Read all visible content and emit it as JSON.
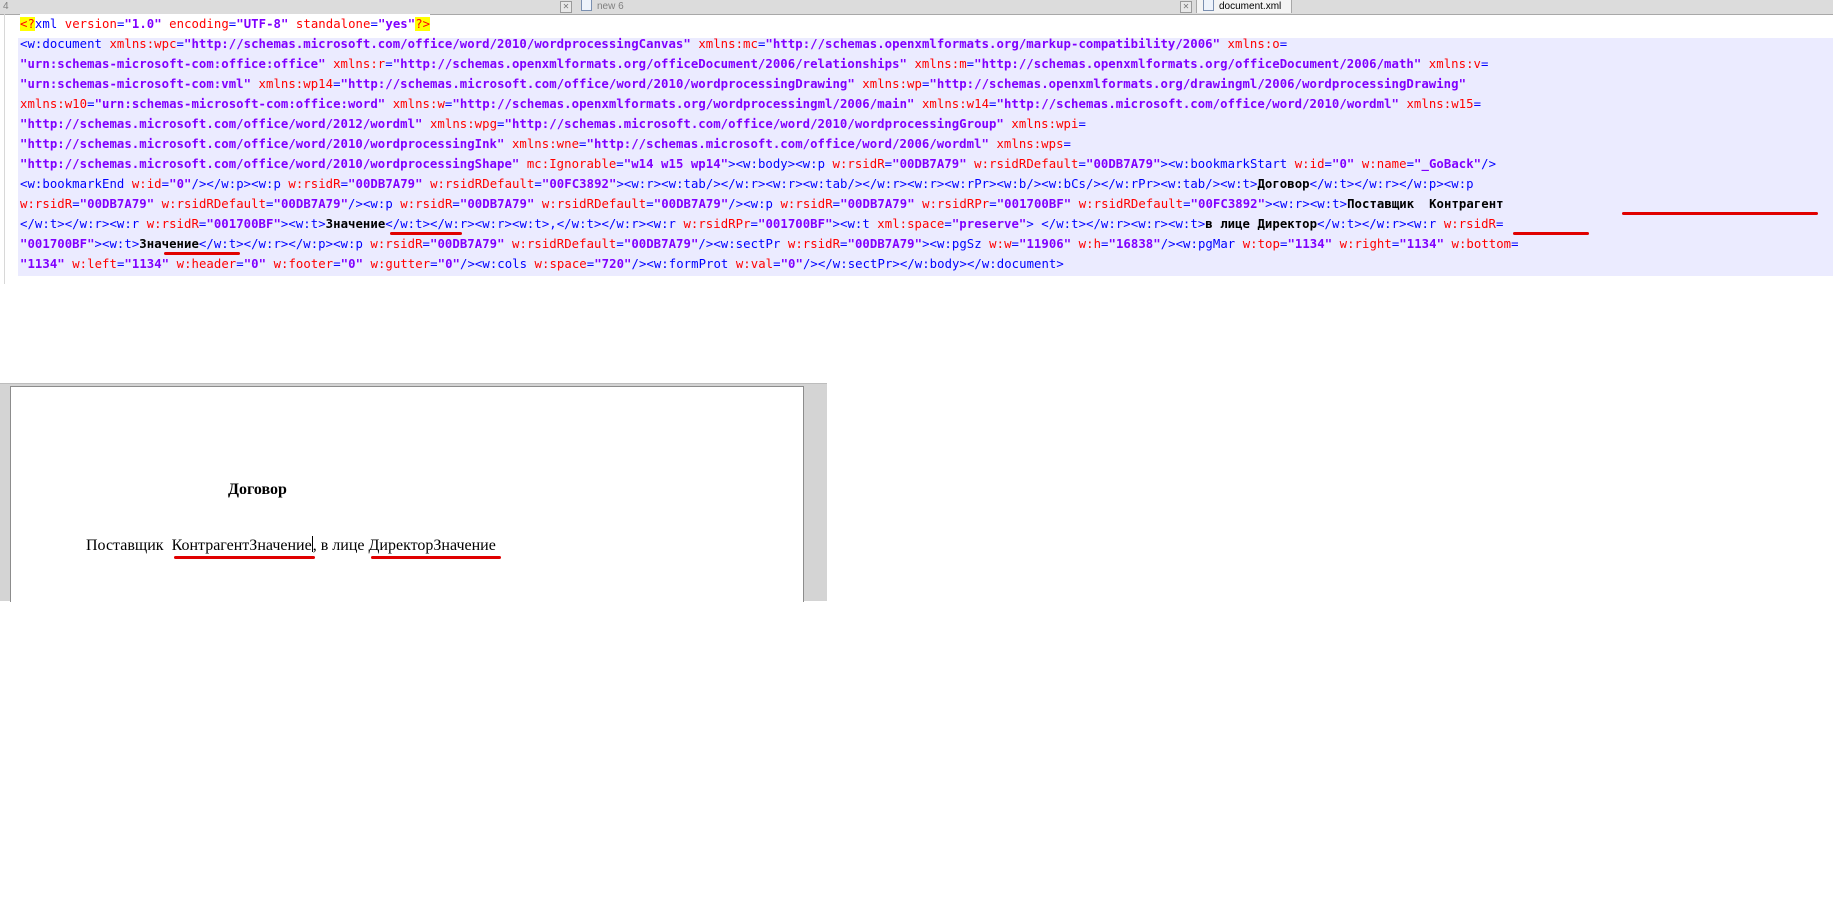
{
  "tabs": [
    {
      "label": "4",
      "active": false
    },
    {
      "label": "new 6",
      "active": false
    },
    {
      "label": "document.xml",
      "active": true
    }
  ],
  "editor": {
    "line1": [
      {
        "cls": "pi",
        "t": "<?"
      },
      {
        "cls": "tag",
        "t": "xml "
      },
      {
        "cls": "attr",
        "t": "version"
      },
      {
        "cls": "tag",
        "t": "="
      },
      {
        "cls": "val",
        "t": "\"1.0\""
      },
      {
        "cls": "tag",
        "t": " "
      },
      {
        "cls": "attr",
        "t": "encoding"
      },
      {
        "cls": "tag",
        "t": "="
      },
      {
        "cls": "val",
        "t": "\"UTF-8\""
      },
      {
        "cls": "tag",
        "t": " "
      },
      {
        "cls": "attr",
        "t": "standalone"
      },
      {
        "cls": "tag",
        "t": "="
      },
      {
        "cls": "val",
        "t": "\"yes\""
      },
      {
        "cls": "pi",
        "t": "?>"
      }
    ],
    "lines": [
      [
        {
          "cls": "tag",
          "t": "<w:document "
        },
        {
          "cls": "attr",
          "t": "xmlns:wpc"
        },
        {
          "cls": "tag",
          "t": "="
        },
        {
          "cls": "val",
          "t": "\"http://schemas.microsoft.com/office/word/2010/wordprocessingCanvas\""
        },
        {
          "cls": "tag",
          "t": " "
        },
        {
          "cls": "attr",
          "t": "xmlns:mc"
        },
        {
          "cls": "tag",
          "t": "="
        },
        {
          "cls": "val",
          "t": "\"http://schemas.openxmlformats.org/markup-compatibility/2006\""
        },
        {
          "cls": "tag",
          "t": " "
        },
        {
          "cls": "attr",
          "t": "xmlns:o"
        },
        {
          "cls": "tag",
          "t": "="
        }
      ],
      [
        {
          "cls": "val",
          "t": "\"urn:schemas-microsoft-com:office:office\""
        },
        {
          "cls": "tag",
          "t": " "
        },
        {
          "cls": "attr",
          "t": "xmlns:r"
        },
        {
          "cls": "tag",
          "t": "="
        },
        {
          "cls": "val",
          "t": "\"http://schemas.openxmlformats.org/officeDocument/2006/relationships\""
        },
        {
          "cls": "tag",
          "t": " "
        },
        {
          "cls": "attr",
          "t": "xmlns:m"
        },
        {
          "cls": "tag",
          "t": "="
        },
        {
          "cls": "val",
          "t": "\"http://schemas.openxmlformats.org/officeDocument/2006/math\""
        },
        {
          "cls": "tag",
          "t": " "
        },
        {
          "cls": "attr",
          "t": "xmlns:v"
        },
        {
          "cls": "tag",
          "t": "="
        }
      ],
      [
        {
          "cls": "val",
          "t": "\"urn:schemas-microsoft-com:vml\""
        },
        {
          "cls": "tag",
          "t": " "
        },
        {
          "cls": "attr",
          "t": "xmlns:wp14"
        },
        {
          "cls": "tag",
          "t": "="
        },
        {
          "cls": "val",
          "t": "\"http://schemas.microsoft.com/office/word/2010/wordprocessingDrawing\""
        },
        {
          "cls": "tag",
          "t": " "
        },
        {
          "cls": "attr",
          "t": "xmlns:wp"
        },
        {
          "cls": "tag",
          "t": "="
        },
        {
          "cls": "val",
          "t": "\"http://schemas.openxmlformats.org/drawingml/2006/wordprocessingDrawing\""
        }
      ],
      [
        {
          "cls": "attr",
          "t": "xmlns:w10"
        },
        {
          "cls": "tag",
          "t": "="
        },
        {
          "cls": "val",
          "t": "\"urn:schemas-microsoft-com:office:word\""
        },
        {
          "cls": "tag",
          "t": " "
        },
        {
          "cls": "attr",
          "t": "xmlns:w"
        },
        {
          "cls": "tag",
          "t": "="
        },
        {
          "cls": "val",
          "t": "\"http://schemas.openxmlformats.org/wordprocessingml/2006/main\""
        },
        {
          "cls": "tag",
          "t": " "
        },
        {
          "cls": "attr",
          "t": "xmlns:w14"
        },
        {
          "cls": "tag",
          "t": "="
        },
        {
          "cls": "val",
          "t": "\"http://schemas.microsoft.com/office/word/2010/wordml\""
        },
        {
          "cls": "tag",
          "t": " "
        },
        {
          "cls": "attr",
          "t": "xmlns:w15"
        },
        {
          "cls": "tag",
          "t": "="
        }
      ],
      [
        {
          "cls": "val",
          "t": "\"http://schemas.microsoft.com/office/word/2012/wordml\""
        },
        {
          "cls": "tag",
          "t": " "
        },
        {
          "cls": "attr",
          "t": "xmlns:wpg"
        },
        {
          "cls": "tag",
          "t": "="
        },
        {
          "cls": "val",
          "t": "\"http://schemas.microsoft.com/office/word/2010/wordprocessingGroup\""
        },
        {
          "cls": "tag",
          "t": " "
        },
        {
          "cls": "attr",
          "t": "xmlns:wpi"
        },
        {
          "cls": "tag",
          "t": "="
        }
      ],
      [
        {
          "cls": "val",
          "t": "\"http://schemas.microsoft.com/office/word/2010/wordprocessingInk\""
        },
        {
          "cls": "tag",
          "t": " "
        },
        {
          "cls": "attr",
          "t": "xmlns:wne"
        },
        {
          "cls": "tag",
          "t": "="
        },
        {
          "cls": "val",
          "t": "\"http://schemas.microsoft.com/office/word/2006/wordml\""
        },
        {
          "cls": "tag",
          "t": " "
        },
        {
          "cls": "attr",
          "t": "xmlns:wps"
        },
        {
          "cls": "tag",
          "t": "="
        }
      ],
      [
        {
          "cls": "val",
          "t": "\"http://schemas.microsoft.com/office/word/2010/wordprocessingShape\""
        },
        {
          "cls": "tag",
          "t": " "
        },
        {
          "cls": "attr",
          "t": "mc:Ignorable"
        },
        {
          "cls": "tag",
          "t": "="
        },
        {
          "cls": "val",
          "t": "\"w14 w15 wp14\""
        },
        {
          "cls": "tag",
          "t": "><w:body><w:p "
        },
        {
          "cls": "attr",
          "t": "w:rsidR"
        },
        {
          "cls": "tag",
          "t": "="
        },
        {
          "cls": "val",
          "t": "\"00DB7A79\""
        },
        {
          "cls": "tag",
          "t": " "
        },
        {
          "cls": "attr",
          "t": "w:rsidRDefault"
        },
        {
          "cls": "tag",
          "t": "="
        },
        {
          "cls": "val",
          "t": "\"00DB7A79\""
        },
        {
          "cls": "tag",
          "t": "><w:bookmarkStart "
        },
        {
          "cls": "attr",
          "t": "w:id"
        },
        {
          "cls": "tag",
          "t": "="
        },
        {
          "cls": "val",
          "t": "\"0\""
        },
        {
          "cls": "tag",
          "t": " "
        },
        {
          "cls": "attr",
          "t": "w:name"
        },
        {
          "cls": "tag",
          "t": "="
        },
        {
          "cls": "val",
          "t": "\"_GoBack\""
        },
        {
          "cls": "tag",
          "t": "/>"
        }
      ],
      [
        {
          "cls": "tag",
          "t": "<w:bookmarkEnd "
        },
        {
          "cls": "attr",
          "t": "w:id"
        },
        {
          "cls": "tag",
          "t": "="
        },
        {
          "cls": "val",
          "t": "\"0\""
        },
        {
          "cls": "tag",
          "t": "/></w:p><w:p "
        },
        {
          "cls": "attr",
          "t": "w:rsidR"
        },
        {
          "cls": "tag",
          "t": "="
        },
        {
          "cls": "val",
          "t": "\"00DB7A79\""
        },
        {
          "cls": "tag",
          "t": " "
        },
        {
          "cls": "attr",
          "t": "w:rsidRDefault"
        },
        {
          "cls": "tag",
          "t": "="
        },
        {
          "cls": "val",
          "t": "\"00FC3892\""
        },
        {
          "cls": "tag",
          "t": "><w:r><w:tab/></w:r><w:r><w:tab/></w:r><w:r><w:rPr><w:b/><w:bCs/></w:rPr><w:tab/><w:t>"
        },
        {
          "cls": "txt",
          "t": "Договор"
        },
        {
          "cls": "tag",
          "t": "</w:t></w:r></w:p><w:p"
        }
      ],
      [
        {
          "cls": "attr",
          "t": "w:rsidR"
        },
        {
          "cls": "tag",
          "t": "="
        },
        {
          "cls": "val",
          "t": "\"00DB7A79\""
        },
        {
          "cls": "tag",
          "t": " "
        },
        {
          "cls": "attr",
          "t": "w:rsidRDefault"
        },
        {
          "cls": "tag",
          "t": "="
        },
        {
          "cls": "val",
          "t": "\"00DB7A79\""
        },
        {
          "cls": "tag",
          "t": "/><w:p "
        },
        {
          "cls": "attr",
          "t": "w:rsidR"
        },
        {
          "cls": "tag",
          "t": "="
        },
        {
          "cls": "val",
          "t": "\"00DB7A79\""
        },
        {
          "cls": "tag",
          "t": " "
        },
        {
          "cls": "attr",
          "t": "w:rsidRDefault"
        },
        {
          "cls": "tag",
          "t": "="
        },
        {
          "cls": "val",
          "t": "\"00DB7A79\""
        },
        {
          "cls": "tag",
          "t": "/><w:p "
        },
        {
          "cls": "attr",
          "t": "w:rsidR"
        },
        {
          "cls": "tag",
          "t": "="
        },
        {
          "cls": "val",
          "t": "\"00DB7A79\""
        },
        {
          "cls": "tag",
          "t": " "
        },
        {
          "cls": "attr",
          "t": "w:rsidRPr"
        },
        {
          "cls": "tag",
          "t": "="
        },
        {
          "cls": "val",
          "t": "\"001700BF\""
        },
        {
          "cls": "tag",
          "t": " "
        },
        {
          "cls": "attr",
          "t": "w:rsidRDefault"
        },
        {
          "cls": "tag",
          "t": "="
        },
        {
          "cls": "val",
          "t": "\"00FC3892\""
        },
        {
          "cls": "tag",
          "t": "><w:r><w:t>"
        },
        {
          "cls": "txt",
          "t": "Поставщик  Контрагент"
        }
      ],
      [
        {
          "cls": "tag",
          "t": "</w:t></w:r><w:r "
        },
        {
          "cls": "attr",
          "t": "w:rsidR"
        },
        {
          "cls": "tag",
          "t": "="
        },
        {
          "cls": "val",
          "t": "\"001700BF\""
        },
        {
          "cls": "tag",
          "t": "><w:t>"
        },
        {
          "cls": "txt",
          "t": "Значение"
        },
        {
          "cls": "tag",
          "t": "</w:t></w:r><w:r><w:t>,</w:t></w:r><w:r "
        },
        {
          "cls": "attr",
          "t": "w:rsidRPr"
        },
        {
          "cls": "tag",
          "t": "="
        },
        {
          "cls": "val",
          "t": "\"001700BF\""
        },
        {
          "cls": "tag",
          "t": "><w:t "
        },
        {
          "cls": "attr",
          "t": "xml:space"
        },
        {
          "cls": "tag",
          "t": "="
        },
        {
          "cls": "val",
          "t": "\"preserve\""
        },
        {
          "cls": "tag",
          "t": "> </w:t></w:r><w:r><w:t>"
        },
        {
          "cls": "txt",
          "t": "в лице Директор"
        },
        {
          "cls": "tag",
          "t": "</w:t></w:r><w:r "
        },
        {
          "cls": "attr",
          "t": "w:rsidR"
        },
        {
          "cls": "tag",
          "t": "="
        }
      ],
      [
        {
          "cls": "val",
          "t": "\"001700BF\""
        },
        {
          "cls": "tag",
          "t": "><w:t>"
        },
        {
          "cls": "txt",
          "t": "Значение"
        },
        {
          "cls": "tag",
          "t": "</w:t></w:r></w:p><w:p "
        },
        {
          "cls": "attr",
          "t": "w:rsidR"
        },
        {
          "cls": "tag",
          "t": "="
        },
        {
          "cls": "val",
          "t": "\"00DB7A79\""
        },
        {
          "cls": "tag",
          "t": " "
        },
        {
          "cls": "attr",
          "t": "w:rsidRDefault"
        },
        {
          "cls": "tag",
          "t": "="
        },
        {
          "cls": "val",
          "t": "\"00DB7A79\""
        },
        {
          "cls": "tag",
          "t": "/><w:sectPr "
        },
        {
          "cls": "attr",
          "t": "w:rsidR"
        },
        {
          "cls": "tag",
          "t": "="
        },
        {
          "cls": "val",
          "t": "\"00DB7A79\""
        },
        {
          "cls": "tag",
          "t": "><w:pgSz "
        },
        {
          "cls": "attr",
          "t": "w:w"
        },
        {
          "cls": "tag",
          "t": "="
        },
        {
          "cls": "val",
          "t": "\"11906\""
        },
        {
          "cls": "tag",
          "t": " "
        },
        {
          "cls": "attr",
          "t": "w:h"
        },
        {
          "cls": "tag",
          "t": "="
        },
        {
          "cls": "val",
          "t": "\"16838\""
        },
        {
          "cls": "tag",
          "t": "/><w:pgMar "
        },
        {
          "cls": "attr",
          "t": "w:top"
        },
        {
          "cls": "tag",
          "t": "="
        },
        {
          "cls": "val",
          "t": "\"1134\""
        },
        {
          "cls": "tag",
          "t": " "
        },
        {
          "cls": "attr",
          "t": "w:right"
        },
        {
          "cls": "tag",
          "t": "="
        },
        {
          "cls": "val",
          "t": "\"1134\""
        },
        {
          "cls": "tag",
          "t": " "
        },
        {
          "cls": "attr",
          "t": "w:bottom"
        },
        {
          "cls": "tag",
          "t": "="
        }
      ],
      [
        {
          "cls": "val",
          "t": "\"1134\""
        },
        {
          "cls": "tag",
          "t": " "
        },
        {
          "cls": "attr",
          "t": "w:left"
        },
        {
          "cls": "tag",
          "t": "="
        },
        {
          "cls": "val",
          "t": "\"1134\""
        },
        {
          "cls": "tag",
          "t": " "
        },
        {
          "cls": "attr",
          "t": "w:header"
        },
        {
          "cls": "tag",
          "t": "="
        },
        {
          "cls": "val",
          "t": "\"0\""
        },
        {
          "cls": "tag",
          "t": " "
        },
        {
          "cls": "attr",
          "t": "w:footer"
        },
        {
          "cls": "tag",
          "t": "="
        },
        {
          "cls": "val",
          "t": "\"0\""
        },
        {
          "cls": "tag",
          "t": " "
        },
        {
          "cls": "attr",
          "t": "w:gutter"
        },
        {
          "cls": "tag",
          "t": "="
        },
        {
          "cls": "val",
          "t": "\"0\""
        },
        {
          "cls": "tag",
          "t": "/><w:cols "
        },
        {
          "cls": "attr",
          "t": "w:space"
        },
        {
          "cls": "tag",
          "t": "="
        },
        {
          "cls": "val",
          "t": "\"720\""
        },
        {
          "cls": "tag",
          "t": "/><w:formProt "
        },
        {
          "cls": "attr",
          "t": "w:val"
        },
        {
          "cls": "tag",
          "t": "="
        },
        {
          "cls": "val",
          "t": "\"0\""
        },
        {
          "cls": "tag",
          "t": "/></w:sectPr></w:body></w:document>"
        }
      ]
    ]
  },
  "preview": {
    "title": "Договор",
    "line_prefix": "Поставщик  ",
    "field1": "КонтрагентЗначение",
    "line_middle": ", в лице ",
    "field2": "ДиректорЗначение"
  },
  "colors": {
    "tag": "#0000ff",
    "attribute": "#ff0000",
    "value": "#8000ff",
    "annotation": "#e00000",
    "line_highlight": "#ebebff"
  }
}
